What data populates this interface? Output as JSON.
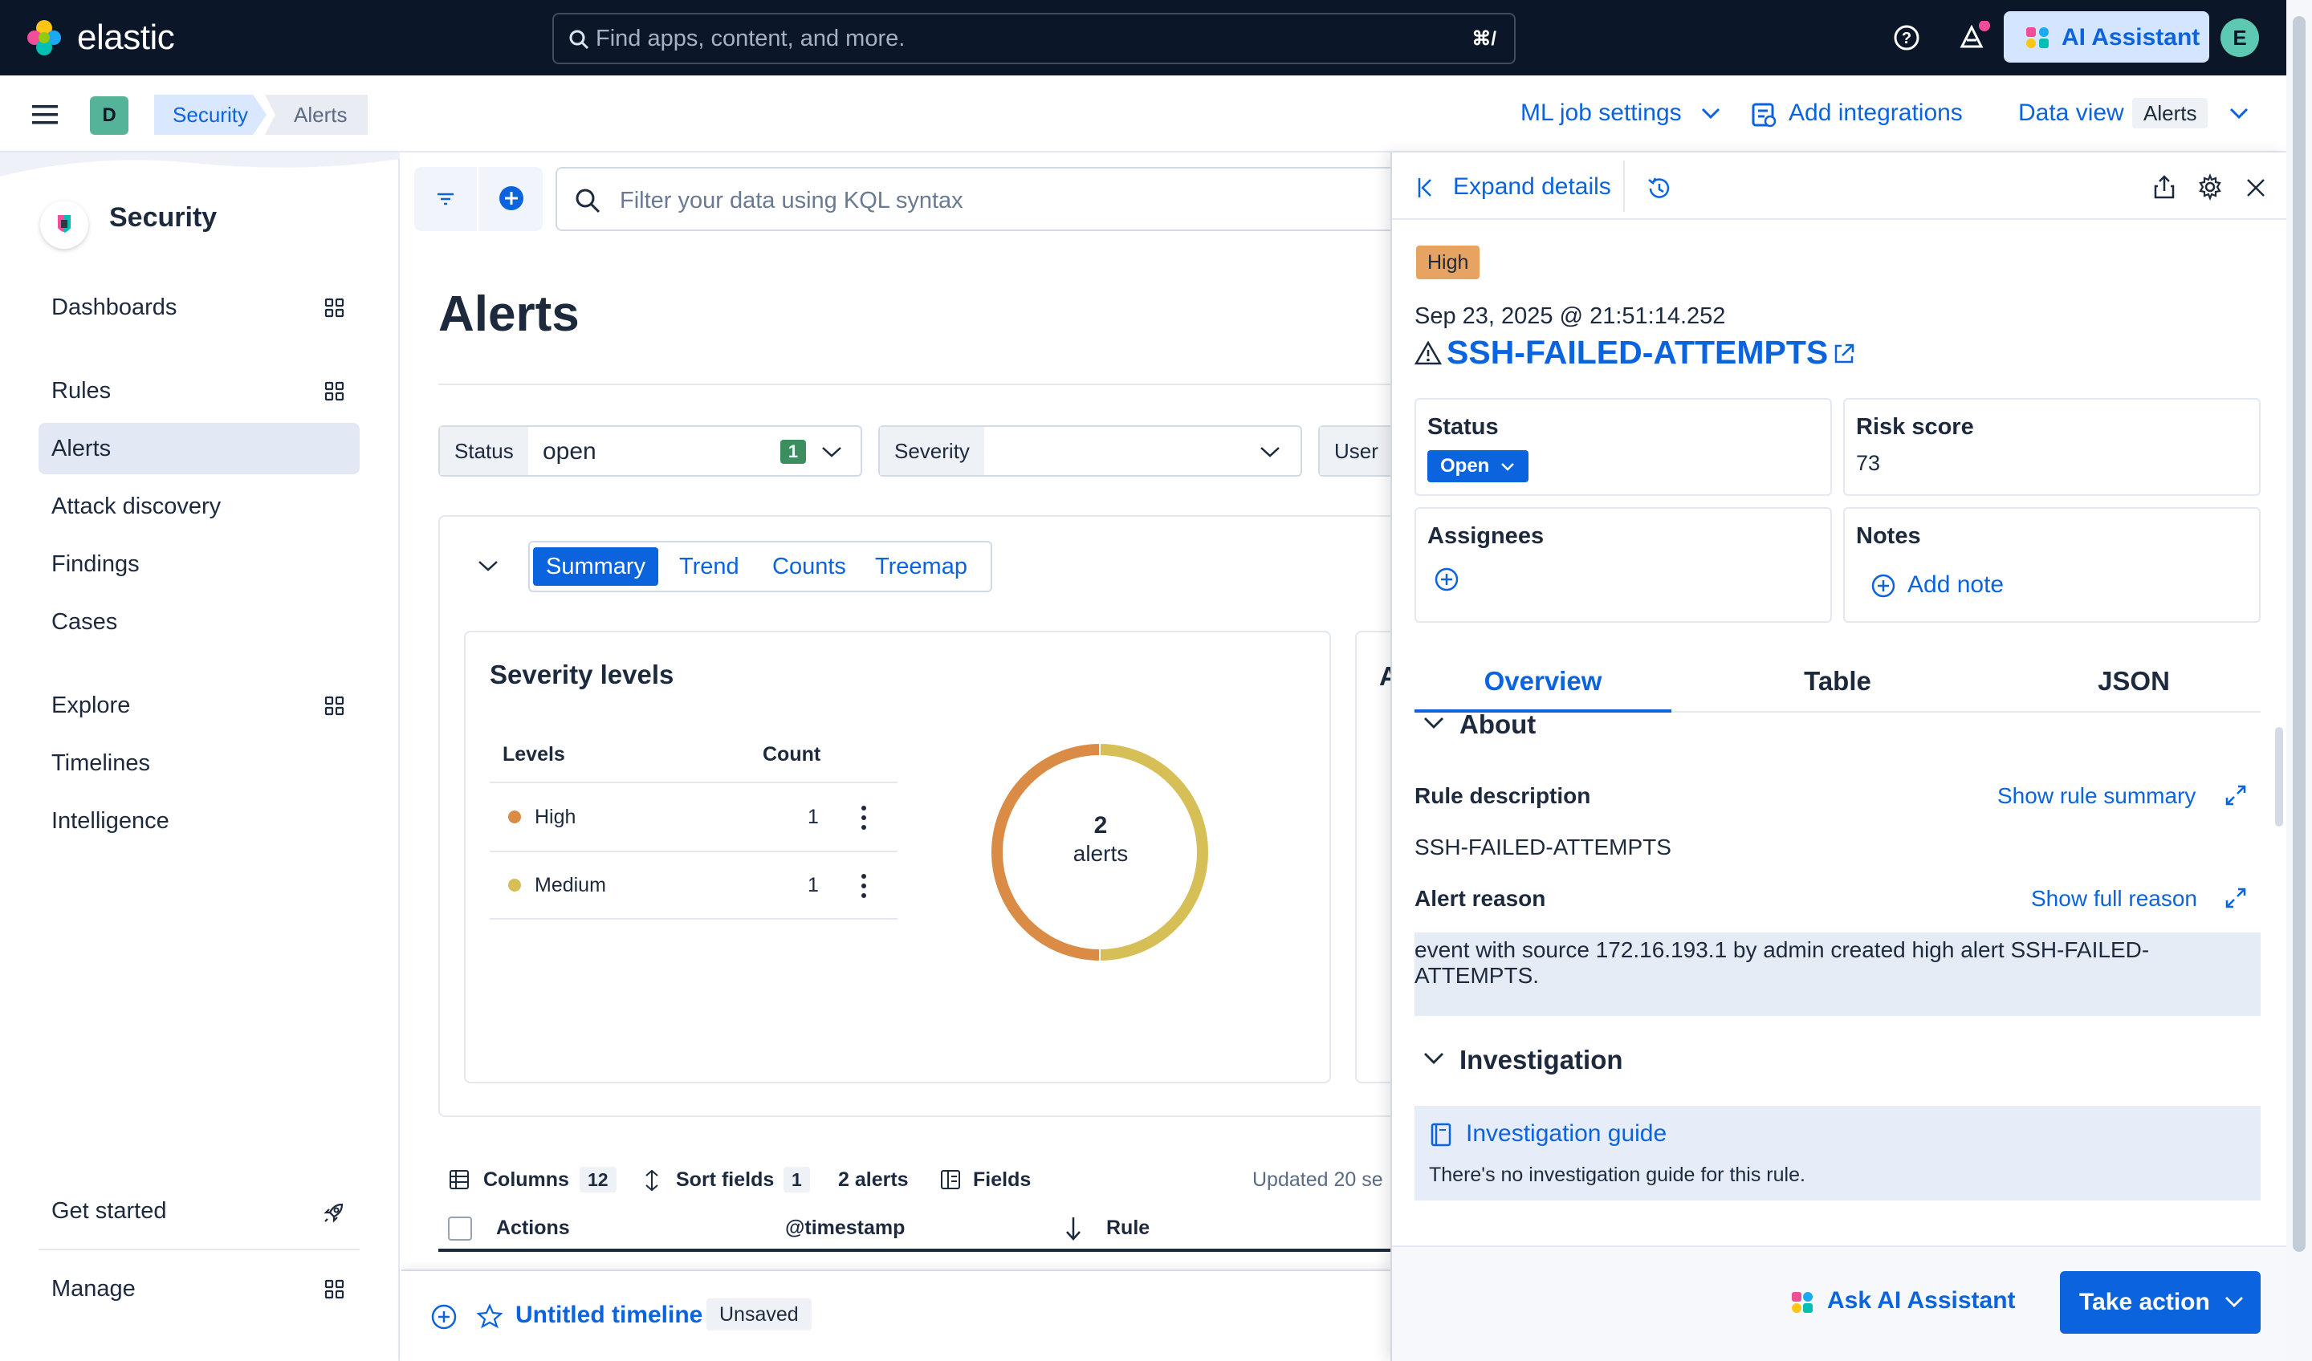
{
  "header": {
    "brand": "elastic",
    "search_placeholder": "Find apps, content, and more.",
    "search_shortcut": "⌘/",
    "ai_assistant_label": "AI Assistant",
    "user_initial": "E"
  },
  "subbar": {
    "space_initial": "D",
    "breadcrumbs": [
      "Security",
      "Alerts"
    ],
    "ml_job_settings": "ML job settings",
    "add_integrations": "Add integrations",
    "data_view_label": "Data view",
    "data_view_value": "Alerts"
  },
  "sidebar": {
    "title": "Security",
    "items": [
      {
        "label": "Dashboards",
        "grid": true
      },
      {
        "label": "Rules",
        "grid": true
      },
      {
        "label": "Alerts",
        "active": true
      },
      {
        "label": "Attack discovery"
      },
      {
        "label": "Findings"
      },
      {
        "label": "Cases"
      },
      {
        "label": "Explore",
        "grid": true
      },
      {
        "label": "Timelines"
      },
      {
        "label": "Intelligence"
      },
      {
        "label": "Get started"
      },
      {
        "label": "Manage",
        "grid": true
      }
    ]
  },
  "main": {
    "kql_placeholder": "Filter your data using KQL syntax",
    "title": "Alerts",
    "filters": {
      "status_label": "Status",
      "status_value": "open",
      "status_count": "1",
      "severity_label": "Severity",
      "user_label": "User"
    },
    "viz_tabs": [
      "Summary",
      "Trend",
      "Counts",
      "Treemap"
    ],
    "active_viz_tab": "Summary",
    "severity_card": {
      "title": "Severity levels",
      "col_levels": "Levels",
      "col_count": "Count",
      "rows": [
        {
          "level": "High",
          "count": "1",
          "color": "#da8b45"
        },
        {
          "level": "Medium",
          "count": "1",
          "color": "#d6bf57"
        }
      ],
      "donut_total": "2",
      "donut_label": "alerts"
    },
    "second_card_letter": "A",
    "table_toolbar": {
      "columns_label": "Columns",
      "columns_count": "12",
      "sort_label": "Sort fields",
      "sort_count": "1",
      "alerts_count": "2 alerts",
      "fields_label": "Fields",
      "updated": "Updated 20 se"
    },
    "table_headers": [
      "Actions",
      "@timestamp",
      "Rule"
    ]
  },
  "timeline": {
    "title": "Untitled timeline",
    "badge": "Unsaved"
  },
  "flyout": {
    "expand_details": "Expand details",
    "severity": "High",
    "timestamp": "Sep 23, 2025 @ 21:51:14.252",
    "rule_name": "SSH-FAILED-ATTEMPTS",
    "status_title": "Status",
    "status_value": "Open",
    "risk_title": "Risk score",
    "risk_value": "73",
    "assignees_title": "Assignees",
    "notes_title": "Notes",
    "add_note": "Add note",
    "tabs": [
      "Overview",
      "Table",
      "JSON"
    ],
    "active_tab": "Overview",
    "about_title": "About",
    "rule_description_label": "Rule description",
    "show_rule_summary": "Show rule summary",
    "rule_description_value": "SSH-FAILED-ATTEMPTS",
    "alert_reason_label": "Alert reason",
    "show_full_reason": "Show full reason",
    "alert_reason_value": "event with source 172.16.193.1 by admin created high alert SSH-FAILED-ATTEMPTS.",
    "investigation_title": "Investigation",
    "investigation_guide": "Investigation guide",
    "investigation_guide_desc": "There's no investigation guide for this rule.",
    "ask_ai": "Ask AI Assistant",
    "take_action": "Take action"
  },
  "colors": {
    "header_bg": "#0b1628",
    "primary": "#0b64dd",
    "high": "#da8b45",
    "medium": "#d6bf57"
  }
}
